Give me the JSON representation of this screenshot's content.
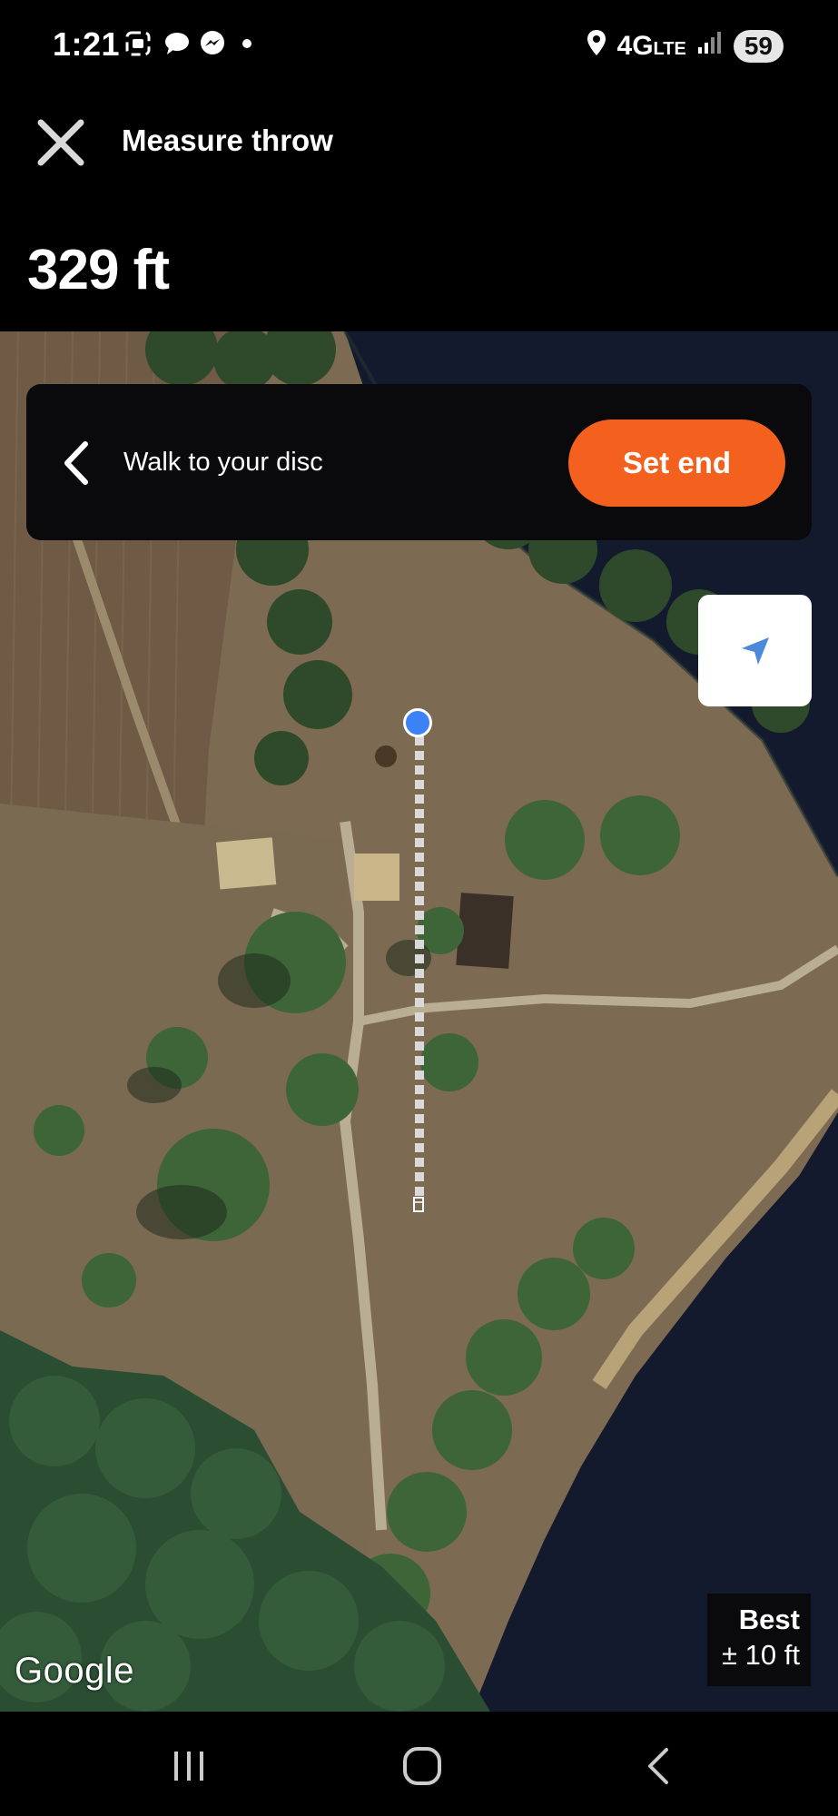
{
  "status_bar": {
    "time": "1:21",
    "network": "4G",
    "network_sub": "LTE",
    "battery": "59"
  },
  "header": {
    "title": "Measure throw",
    "close_icon": "close-icon"
  },
  "distance": "329 ft",
  "instruction": {
    "text": "Walk to your disc",
    "back_icon": "chevron-left-icon",
    "button_label": "Set end",
    "button_color": "#f4611f"
  },
  "map": {
    "type": "satellite",
    "attribution": "Google",
    "locate_icon": "navigation-arrow-icon",
    "start_marker_color": "#3b82f6"
  },
  "accuracy": {
    "label": "Best",
    "value": "± 10 ft"
  },
  "nav_bar": {
    "recents_icon": "recents-icon",
    "home_icon": "home-icon",
    "back_icon": "back-icon"
  }
}
